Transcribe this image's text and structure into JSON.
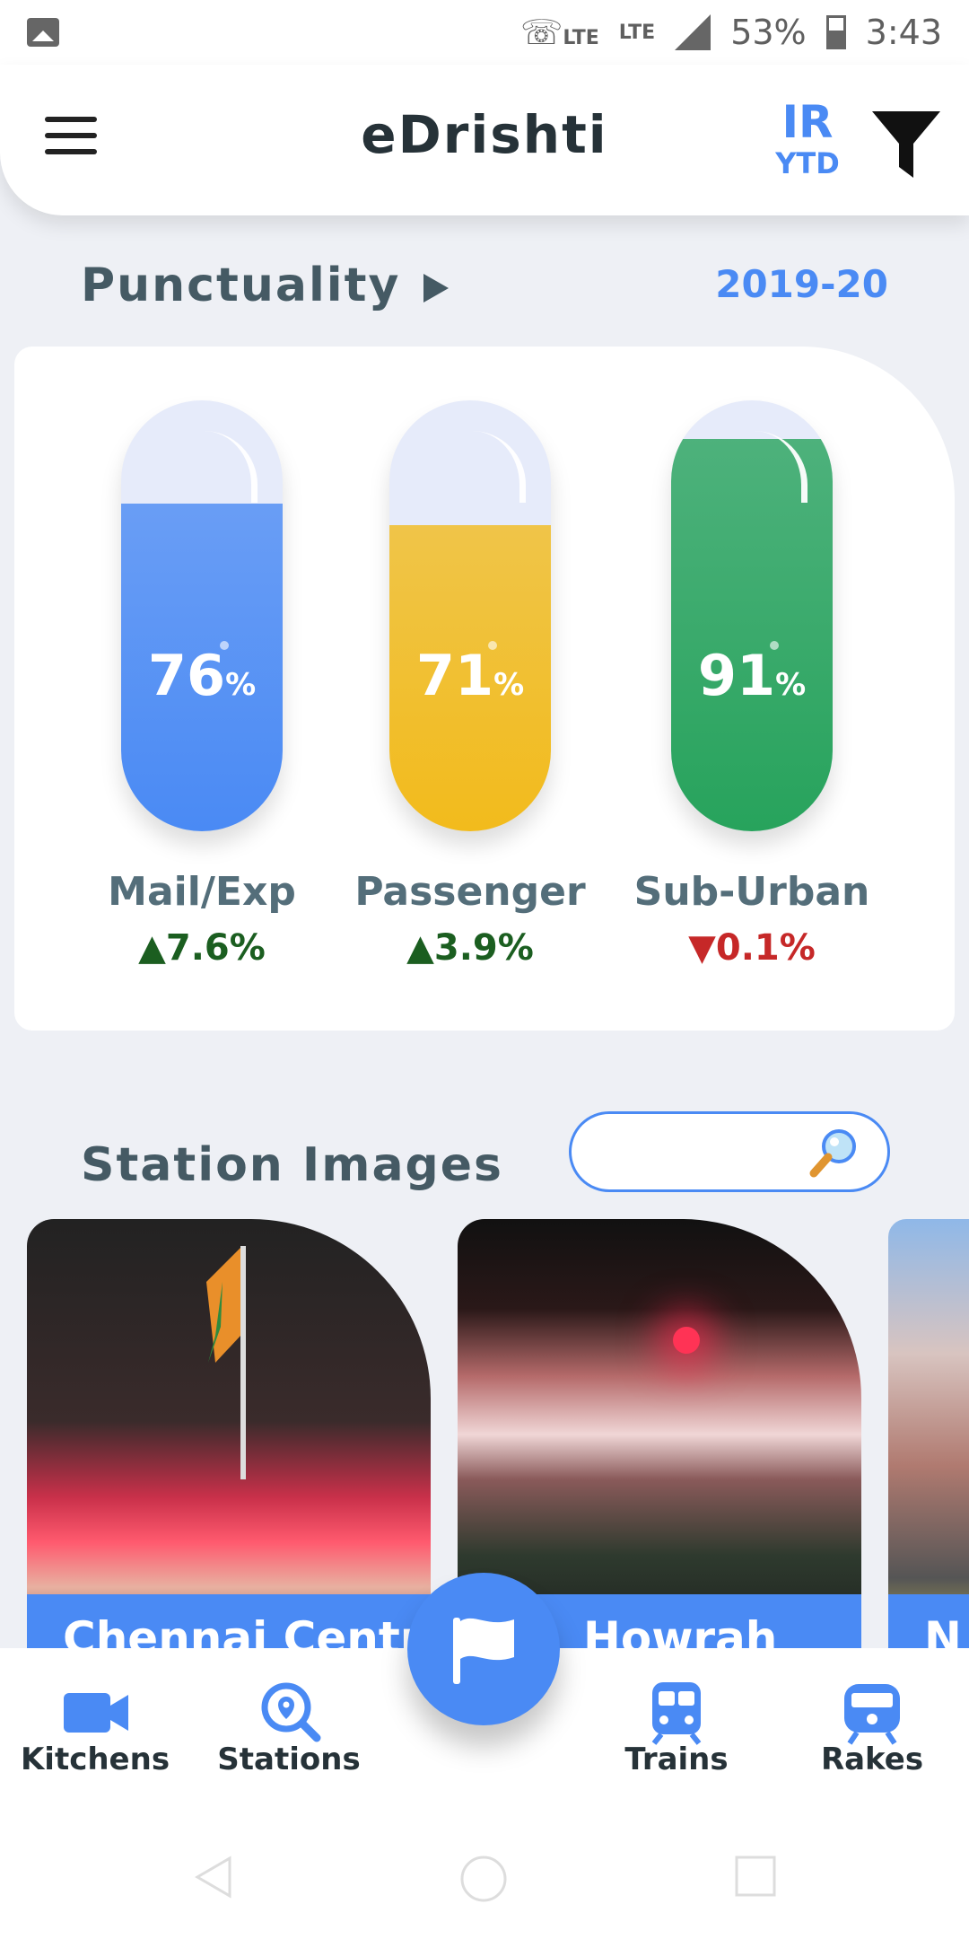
{
  "status_bar": {
    "lte1": "LTE",
    "lte2": "LTE",
    "battery": "53%",
    "time": "3:43"
  },
  "header": {
    "title": "eDrishti",
    "badge_top": "IR",
    "badge_bottom": "YTD"
  },
  "punctuality": {
    "title": "Punctuality",
    "year": "2019-20",
    "gauges": [
      {
        "value": "76",
        "unit": "%",
        "fill_fraction": 0.76,
        "label": "Mail/Exp",
        "change": "▲7.6%",
        "trend": "up",
        "color": "#4a8af4"
      },
      {
        "value": "71",
        "unit": "%",
        "fill_fraction": 0.71,
        "label": "Passenger",
        "change": "▲3.9%",
        "trend": "up",
        "color": "#f2bb1c"
      },
      {
        "value": "91",
        "unit": "%",
        "fill_fraction": 0.91,
        "label": "Sub-Urban",
        "change": "▼0.1%",
        "trend": "down",
        "color": "#27a35c"
      }
    ]
  },
  "station_images": {
    "title": "Station Images",
    "search_placeholder": "",
    "tiles": [
      {
        "caption": "Chennai Central"
      },
      {
        "caption": "Howrah"
      },
      {
        "caption": "N"
      }
    ]
  },
  "bottom_nav": {
    "items": [
      {
        "label": "Kitchens",
        "icon": "video-camera-icon"
      },
      {
        "label": "Stations",
        "icon": "location-search-icon"
      },
      {
        "label": "Trains",
        "icon": "train-icon"
      },
      {
        "label": "Rakes",
        "icon": "rake-icon"
      }
    ],
    "fab_icon": "flag-icon"
  },
  "colors": {
    "accent": "#4a8af4",
    "up": "#1b5e20",
    "down": "#c62828"
  }
}
